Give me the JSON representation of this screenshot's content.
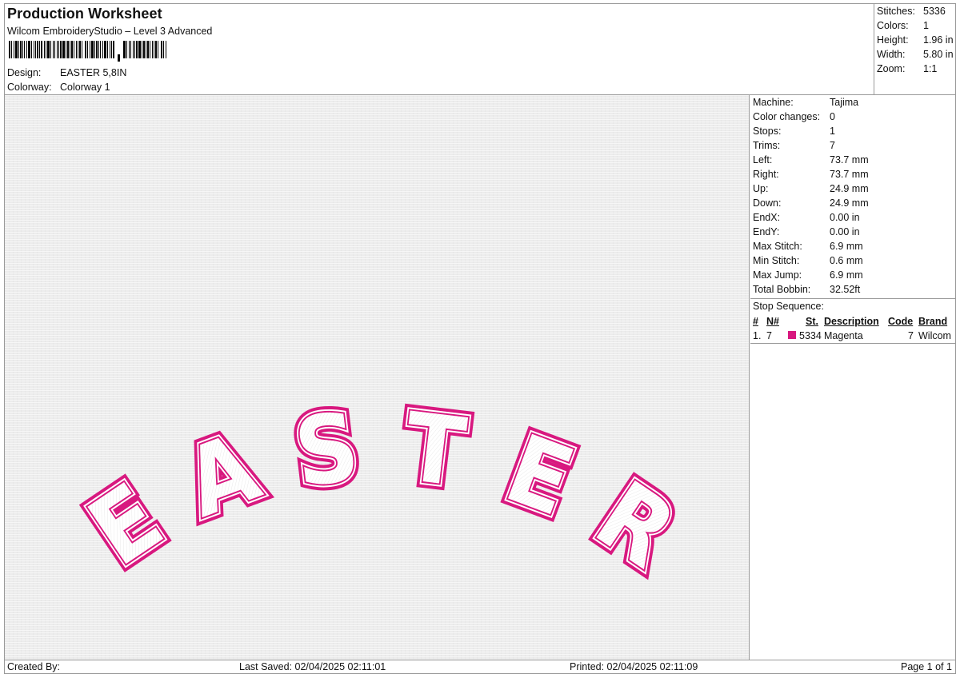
{
  "header": {
    "title": "Production Worksheet",
    "subtitle": "Wilcom EmbroideryStudio – Level 3 Advanced",
    "design_label": "Design:",
    "design_value": "EASTER 5,8IN",
    "colorway_label": "Colorway:",
    "colorway_value": "Colorway 1"
  },
  "summary": {
    "stitches_label": "Stitches:",
    "stitches": "5336",
    "colors_label": "Colors:",
    "colors": "1",
    "height_label": "Height:",
    "height": "1.96 in",
    "width_label": "Width:",
    "width": "5.80 in",
    "zoom_label": "Zoom:",
    "zoom": "1:1"
  },
  "stats": [
    {
      "label": "Machine:",
      "value": "Tajima"
    },
    {
      "label": "Color changes:",
      "value": "0"
    },
    {
      "label": "Stops:",
      "value": "1"
    },
    {
      "label": "Trims:",
      "value": "7"
    },
    {
      "label": "Left:",
      "value": "73.7 mm"
    },
    {
      "label": "Right:",
      "value": "73.7 mm"
    },
    {
      "label": "Up:",
      "value": "24.9 mm"
    },
    {
      "label": "Down:",
      "value": "24.9 mm"
    },
    {
      "label": "EndX:",
      "value": "0.00 in"
    },
    {
      "label": "EndY:",
      "value": "0.00 in"
    },
    {
      "label": "Max Stitch:",
      "value": "6.9 mm"
    },
    {
      "label": "Min Stitch:",
      "value": "0.6 mm"
    },
    {
      "label": "Max Jump:",
      "value": "6.9 mm"
    },
    {
      "label": "Total Bobbin:",
      "value": "32.52ft"
    }
  ],
  "stop_sequence": {
    "title": "Stop Sequence:",
    "columns": {
      "num": "#",
      "n": "N#",
      "st": "St.",
      "description": "Description",
      "code": "Code",
      "brand": "Brand"
    },
    "rows": [
      {
        "num": "1.",
        "n": "7",
        "swatch_color": "#d8187f",
        "st": "5334",
        "description": "Magenta",
        "code": "7",
        "brand": "Wilcom"
      }
    ]
  },
  "design_preview": {
    "letters": [
      "E",
      "A",
      "S",
      "T",
      "E",
      "R"
    ],
    "thread_color": "#d8187f",
    "fill_color": "#ffffff"
  },
  "footer": {
    "created_by": "Created By:",
    "last_saved": "Last Saved: 02/04/2025 02:11:01",
    "printed": "Printed: 02/04/2025 02:11:09",
    "page": "Page 1 of 1"
  }
}
